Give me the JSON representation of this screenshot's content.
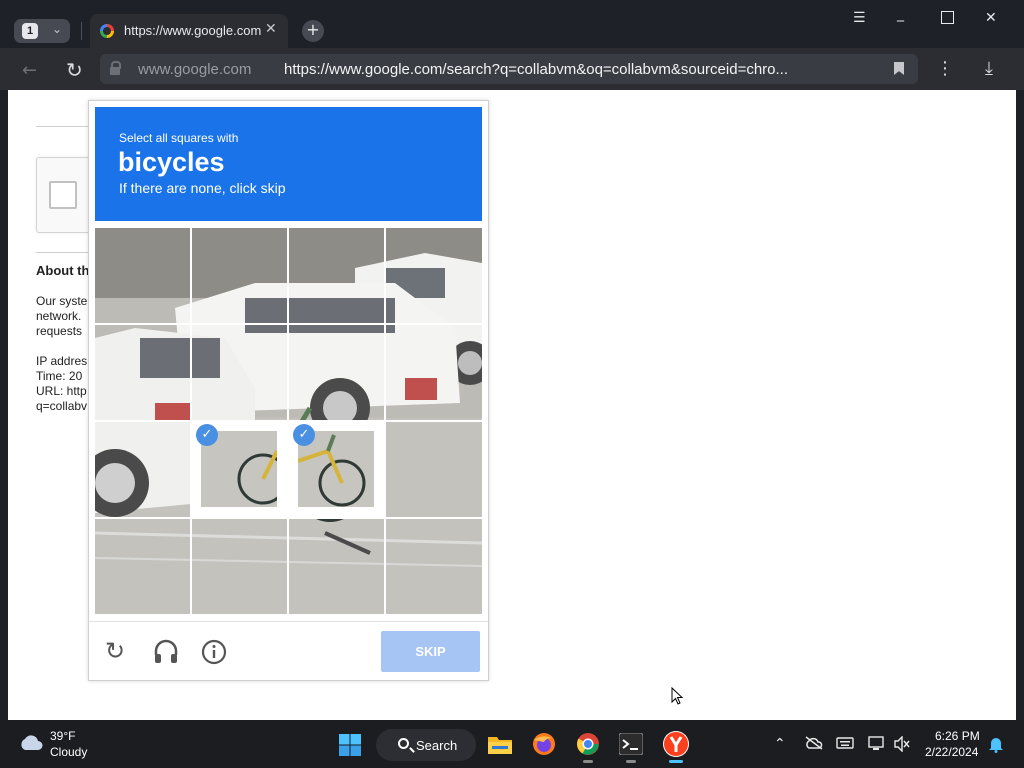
{
  "browser": {
    "tab_count": "1",
    "tab_title": "https://www.google.com",
    "omnibox_domain": "www.google.com",
    "omnibox_url": "https://www.google.com/search?q=collabvm&oq=collabvm&sourceid=chro..."
  },
  "page": {
    "about_heading": "About th",
    "lines": [
      "Our syste",
      "network.",
      "requests",
      "",
      "IP addres",
      "Time: 20",
      "URL: http",
      "q=collabv"
    ]
  },
  "captcha": {
    "instruction": "Select all squares with",
    "target": "bicycles",
    "hint": "If there are none, click skip",
    "skip_label": "SKIP",
    "selected_tiles": [
      10,
      11
    ],
    "accent_color": "#1a73e8"
  },
  "taskbar": {
    "weather_temp": "39°F",
    "weather_desc": "Cloudy",
    "search_label": "Search",
    "time": "6:26 PM",
    "date": "2/22/2024"
  }
}
